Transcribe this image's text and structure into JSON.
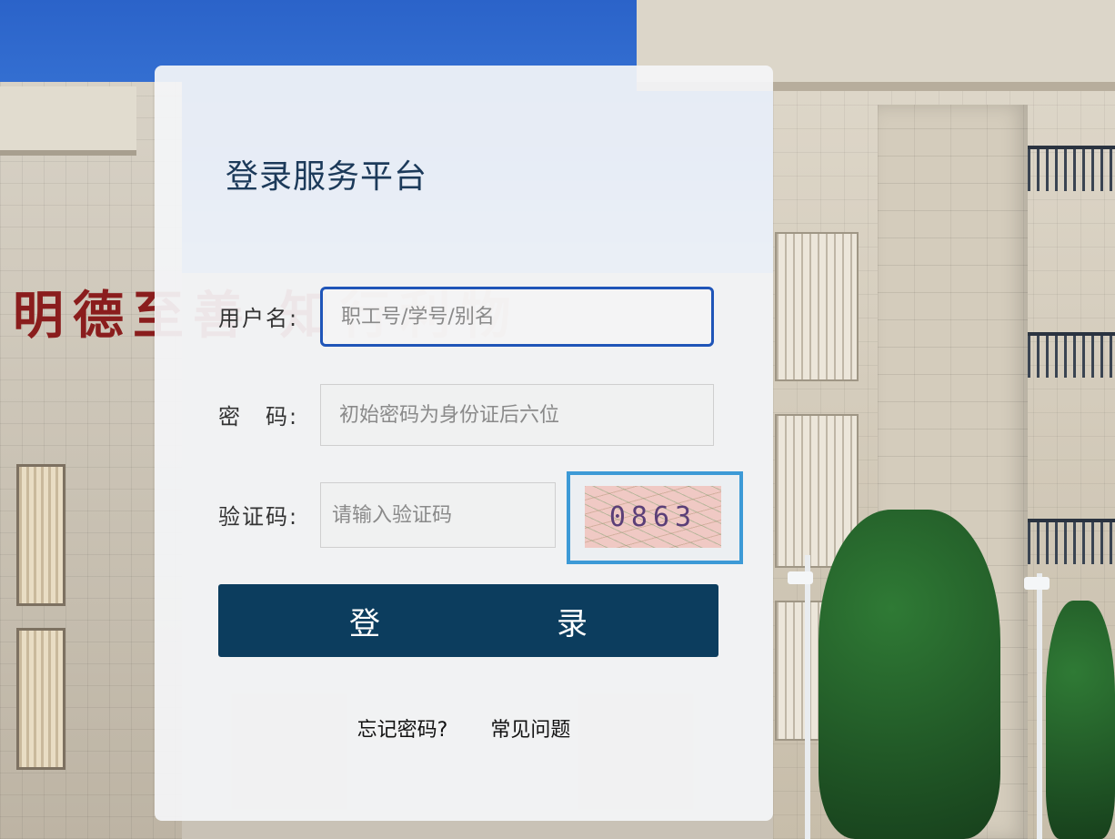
{
  "background": {
    "calligraphy": "明德至善 知行利物"
  },
  "login": {
    "title": "登录服务平台",
    "username": {
      "label": "用户名:",
      "placeholder": "职工号/学号/别名",
      "value": ""
    },
    "password": {
      "label": "密　码:",
      "placeholder": "初始密码为身份证后六位",
      "value": ""
    },
    "captcha": {
      "label": "验证码:",
      "placeholder": "请输入验证码",
      "value": "",
      "image_text": "0863"
    },
    "submit_label": "登　录",
    "forgot_password": "忘记密码?",
    "faq": "常见问题"
  },
  "colors": {
    "card_title": "#1c3a5a",
    "button_bg": "#0c3d5e",
    "focus_border": "#1f55b8",
    "captcha_border": "#3d9ad6"
  }
}
